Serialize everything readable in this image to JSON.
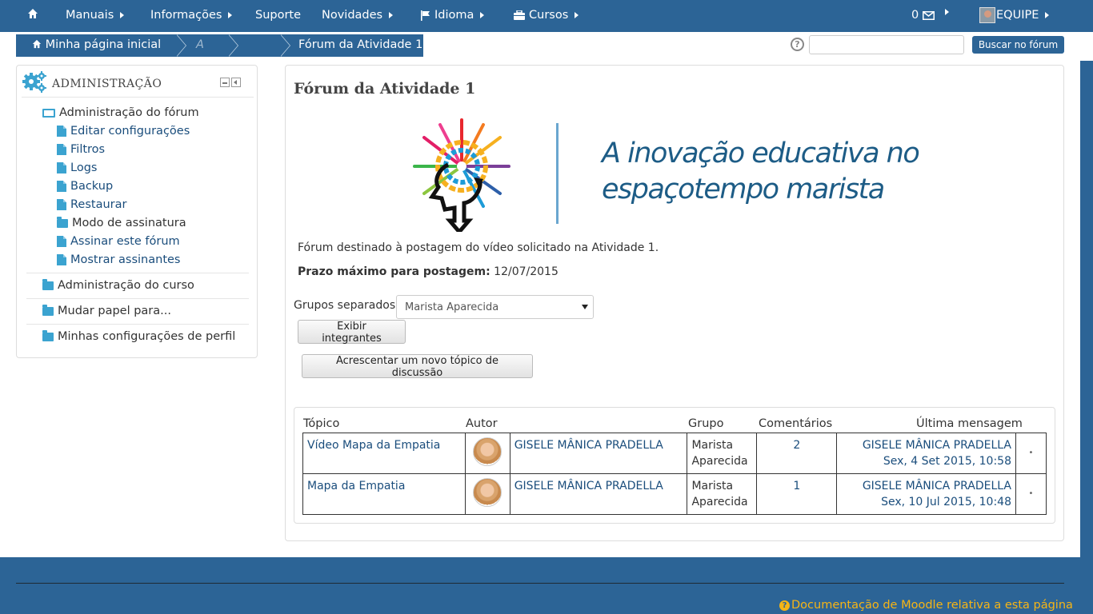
{
  "navbar": {
    "menus": [
      {
        "label": "Manuais"
      },
      {
        "label": "Informações"
      },
      {
        "label": "Suporte"
      },
      {
        "label": "Novidades"
      },
      {
        "label": "Idioma"
      },
      {
        "label": "Cursos"
      }
    ],
    "messages_count": "0",
    "user_label": "EQUIPE"
  },
  "breadcrumb": {
    "items": [
      "Minha página inicial",
      "A",
      "",
      "Fórum da Atividade 1"
    ]
  },
  "search": {
    "placeholder": "",
    "button_label": "Buscar no fórum"
  },
  "admin_block": {
    "title": "ADMINISTRAÇÃO",
    "forum_admin": "Administração do fórum",
    "forum_items": [
      "Editar configurações",
      "Filtros",
      "Logs",
      "Backup",
      "Restaurar"
    ],
    "subscription_mode": "Modo de assinatura",
    "forum_items_2": [
      "Assinar este fórum",
      "Mostrar assinantes"
    ],
    "course_admin": "Administração do curso",
    "switch_role": "Mudar papel para...",
    "profile_settings": "Minhas configurações de perfil"
  },
  "forum": {
    "title": "Fórum da Atividade 1",
    "banner_line1": "A inovação educativa no",
    "banner_line2": "espaçotempo marista",
    "description": "Fórum destinado à postagem do vídeo solicitado na Atividade 1.",
    "deadline_label": "Prazo máximo para postagem:",
    "deadline_value": "12/07/2015",
    "groups_label": "Grupos separados",
    "groups_selected": "Marista Aparecida",
    "show_members_button": "Exibir integrantes",
    "add_topic_button": "Acrescentar um novo tópico de discussão"
  },
  "table": {
    "headers": [
      "Tópico",
      "Autor",
      "Grupo",
      "Comentários",
      "Última mensagem"
    ],
    "rows": [
      {
        "topic": "Vídeo Mapa da Empatia",
        "author": "GISELE MÂNICA PRADELLA",
        "group": "Marista Aparecida",
        "comments": "2",
        "last_author": "GISELE MÂNICA PRADELLA",
        "last_date": "Sex, 4 Set 2015, 10:58"
      },
      {
        "topic": "Mapa da Empatia",
        "author": "GISELE MÂNICA PRADELLA",
        "group": "Marista Aparecida",
        "comments": "1",
        "last_author": "GISELE MÂNICA PRADELLA",
        "last_date": "Sex, 10 Jul 2015, 10:48"
      }
    ]
  },
  "footer": {
    "doc_link": "Documentação de Moodle relativa a esta página"
  },
  "colors": {
    "brand": "#2c6496",
    "link": "#1a4d7c",
    "footer_link": "#f7b515"
  }
}
